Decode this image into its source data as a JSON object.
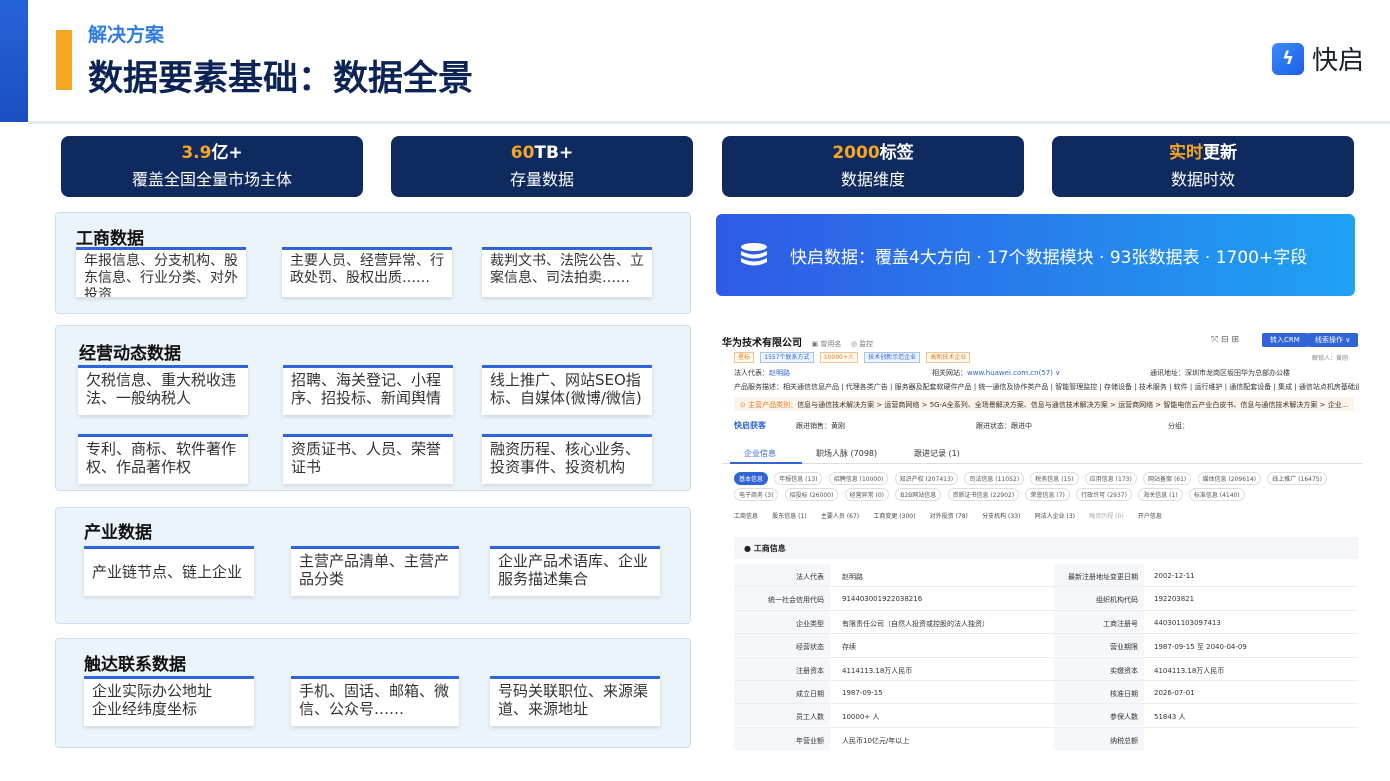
{
  "header": {
    "subtitle": "解决方案",
    "title": "数据要素基础：数据全景",
    "logo_text": "快启"
  },
  "stats": [
    {
      "highlight": "3.9",
      "rest": "亿+",
      "label": "覆盖全国全量市场主体"
    },
    {
      "highlight": "60",
      "rest": "TB+",
      "label": "存量数据"
    },
    {
      "highlight": "2000",
      "rest": "标签",
      "label": "数据维度"
    },
    {
      "highlight": "实时",
      "rest": "更新",
      "label": "数据时效"
    }
  ],
  "groups": [
    {
      "title": "工商数据",
      "cards": [
        "年报信息、分支机构、股东信息、行业分类、对外投资……",
        "主要人员、经营异常、行政处罚、股权出质……",
        "裁判文书、法院公告、立案信息、司法拍卖……"
      ]
    },
    {
      "title": "经营动态数据",
      "cards": [
        "欠税信息、重大税收违法、一般纳税人",
        "招聘、海关登记、小程序、招投标、新闻舆情",
        "线上推广、网站SEO指标、自媒体(微博/微信)",
        "专利、商标、软件著作权、作品著作权",
        "资质证书、人员、荣誉证书",
        "融资历程、核心业务、投资事件、投资机构"
      ]
    },
    {
      "title": "产业数据",
      "cards": [
        "产业链节点、链上企业",
        "主营产品清单、主营产品分类",
        "企业产品术语库、企业服务描述集合"
      ]
    },
    {
      "title": "触达联系数据",
      "cards": [
        "企业实际办公地址\n企业经纬度坐标",
        "手机、固话、邮箱、微信、公众号……",
        "号码关联职位、来源渠道、来源地址"
      ]
    }
  ],
  "banner": {
    "text": "快启数据：覆盖4大方向 · 17个数据模块 · 93张数据表 · 1700+字段",
    "icon": "database-icon"
  },
  "screenshot": {
    "company": "华为技术有限公司",
    "used_name": "曾用名",
    "monitor": "监控",
    "btn_crm": "转入CRM",
    "btn_lead": "线索操作 ∨",
    "tags": [
      "星标",
      "1557个联系方式",
      "10000+人",
      "技术创新示范企业",
      "高新技术企业"
    ],
    "legal_label": "法人代表：",
    "legal": "赵明路",
    "website_label": "相关网站：",
    "website": "www.huawei.com.cn(57) ∨",
    "address_label": "通讯地址：",
    "address": "深圳市龙岗区坂田华为总部办公楼",
    "unlock": "解锁人：黄刚",
    "product_desc": "产品服务描述：相关通信信息产品 | 代理各类广告 | 服务器及配套软硬件产品 | 统一通信及协作类产品 | 智能管理监控 | 存储设备 | 技术服务 | 软件 | 运行维护 | 通信配套设备 | 集成 | 通信站点机房基础设...",
    "main_label": "主营产品类别：",
    "main_product": "信息与通信技术解决方案 > 运营商网络 > 5G-A全系列、全场景解决方案、信息与通信技术解决方案 > 运营商网络 > 智能电信云产业白皮书、信息与通信技术解决方案 > 企业...",
    "brand": "快启获客",
    "follow_sales": "跟进销售：黄刚",
    "follow_status": "跟进状态：跟进中",
    "group_label": "分组：",
    "tabs": [
      "企业信息",
      "职场人脉 (7098)",
      "跟进记录 (1)"
    ],
    "chips_row1": [
      "基本信息",
      "年报信息 (13)",
      "招聘信息 (10000)",
      "知识产权 (207413)",
      "司法信息 (11052)",
      "税务信息 (15)",
      "应用信息 (173)",
      "网站备案 (61)",
      "媒体信息 (209614)",
      "线上推广 (16475)"
    ],
    "chips_row2": [
      "电子商务 (3)",
      "招投标 (26000)",
      "经营异常 (0)",
      "B2B网站信息",
      "资质证书信息 (22902)",
      "荣誉信息 (7)",
      "行政许可 (2937)",
      "海关信息 (1)",
      "标准信息 (4140)"
    ],
    "subtabs": [
      "工商信息",
      "股东信息 (1)",
      "主要人员 (67)",
      "工商变更 (300)",
      "对外投资 (78)",
      "分支机构 (33)",
      "同法人企业 (3)",
      "融资历程 (0)",
      "开户信息"
    ],
    "section": "工商信息",
    "rows": [
      [
        "法人代表",
        "赵明路",
        "最新注册地址变更日期",
        "2002-12-11"
      ],
      [
        "统一社会信用代码",
        "914403001922038216",
        "组织机构代码",
        "192203821"
      ],
      [
        "企业类型",
        "有限责任公司（自然人投资或控股的法人独资）",
        "工商注册号",
        "440301103097413"
      ],
      [
        "经营状态",
        "存续",
        "营业期限",
        "1987-09-15 至 2040-04-09"
      ],
      [
        "注册资本",
        "4114113.18万人民币",
        "实缴资本",
        "4104113.18万人民币"
      ],
      [
        "成立日期",
        "1987-09-15",
        "核准日期",
        "2026-07-01"
      ],
      [
        "员工人数",
        "10000+ 人",
        "参保人数",
        "51843 人"
      ],
      [
        "年营业额",
        "人民币10亿元/年以上",
        "纳税总额",
        ""
      ]
    ]
  }
}
